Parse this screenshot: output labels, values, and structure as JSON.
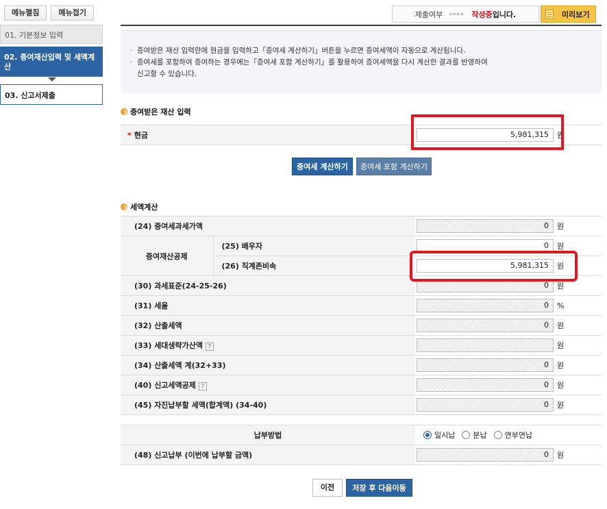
{
  "sidebar": {
    "expand_label": "메뉴펼침",
    "collapse_label": "메뉴접기",
    "items": [
      {
        "label": "01. 기본정보 입력"
      },
      {
        "label": "02. 증여재산입력 및 세액계산"
      },
      {
        "label": "03. 신고서제출"
      }
    ]
  },
  "header": {
    "status_label": "제출여부",
    "status_arrows": "▸▸▸▸",
    "status_value_red": "작성중",
    "status_value_rest": "입니다.",
    "preview_label": "미리보기"
  },
  "info": {
    "line1": "증여받은 재산 입력란에 현금을 입력하고「증여세 계산하기」버튼을 누르면 증여세액이 자동으로 계산됩니다.",
    "line2": "증여세를 포함하여 증여하는 경우에는「증여세 포함 계산하기」를 활용하여 증여세액을 다시 계산한 결과를 반영하여",
    "line3": "신고할 수 있습니다."
  },
  "gift_section": {
    "title": "증여받은 재산 입력",
    "required_mark": "*",
    "cash_label": "현금",
    "cash_value": "5,981,315",
    "unit": "원"
  },
  "calc_buttons": {
    "calc_label": "증여세 계산하기",
    "calc_incl_label": "증여세 포함 계산하기"
  },
  "tax_section": {
    "title": "세액계산",
    "rows": {
      "r24": {
        "label": "(24) 증여세과세가액",
        "value": "0",
        "unit": "원"
      },
      "deduction_group": "증여재산공제",
      "r25": {
        "label": "(25) 배우자",
        "value": "0",
        "unit": "원"
      },
      "r26": {
        "label": "(26) 직계존비속",
        "value": "5,981,315",
        "unit": "원"
      },
      "r30": {
        "label": "(30) 과세표준(24-25-26)",
        "value": "0",
        "unit": "원"
      },
      "r31": {
        "label": "(31) 세율",
        "value": "0",
        "unit": "%"
      },
      "r32": {
        "label": "(32) 산출세액",
        "value": "0",
        "unit": "원"
      },
      "r33": {
        "label": "(33) 세대생략가산액",
        "value": "",
        "unit": "원",
        "help": "?"
      },
      "r34": {
        "label": "(34) 산출세액 계(32+33)",
        "value": "0",
        "unit": "원"
      },
      "r40": {
        "label": "(40) 신고세액공제",
        "value": "0",
        "unit": "원",
        "help": "?"
      },
      "r45": {
        "label": "(45) 자진납부할 세액(합계액) (34-40)",
        "value": "0",
        "unit": "원"
      }
    }
  },
  "payment": {
    "method_label": "납부방법",
    "options": [
      "일시납",
      "분납",
      "연부연납"
    ],
    "selected": "일시납",
    "r48": {
      "label": "(48) 신고납부 (이번에 납부할 금액)",
      "value": "0",
      "unit": "원"
    }
  },
  "footer": {
    "prev_label": "이전",
    "save_next_label": "저장 후 다음이동"
  },
  "colors": {
    "primary_blue": "#2c64a3",
    "highlight_red": "#e4161f",
    "preview_yellow": "#f6c445"
  }
}
